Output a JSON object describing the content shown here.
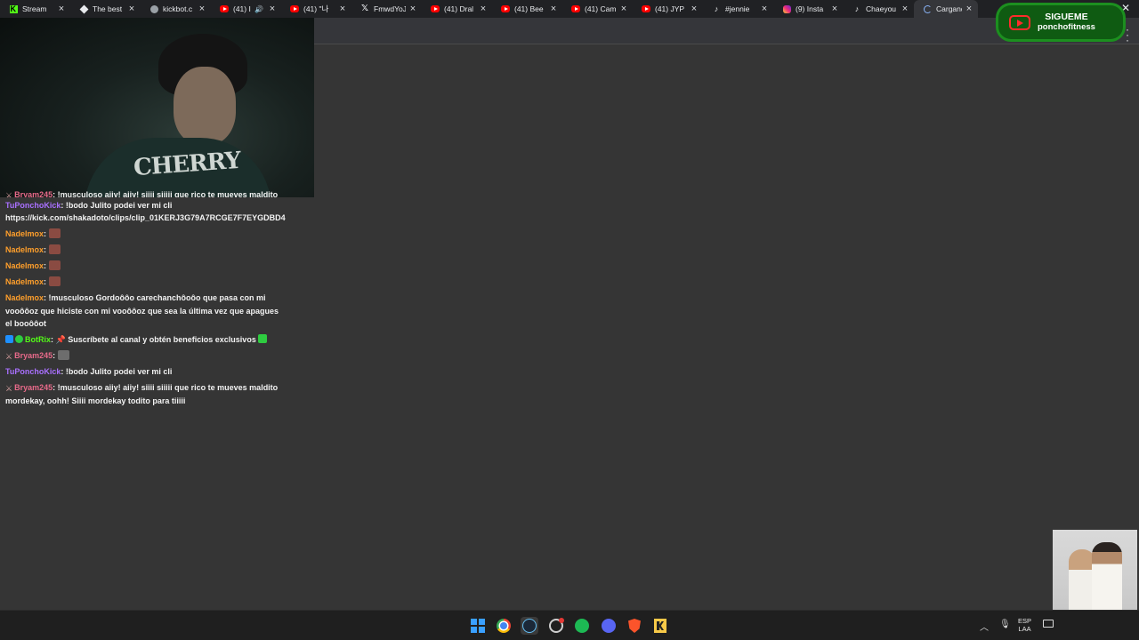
{
  "tabs": [
    {
      "title": "Stream",
      "icon": "kick-icon",
      "active": false
    },
    {
      "title": "The best",
      "icon": "github-icon",
      "active": false
    },
    {
      "title": "kickbot.c",
      "icon": "generic-icon",
      "active": false
    },
    {
      "title": "(41) I",
      "icon": "youtube-icon",
      "active": false,
      "muted": true
    },
    {
      "title": "(41) \"나",
      "icon": "youtube-icon",
      "active": false
    },
    {
      "title": "FmwdYoJ",
      "icon": "x-icon",
      "active": false
    },
    {
      "title": "(41) Dral",
      "icon": "youtube-icon",
      "active": false
    },
    {
      "title": "(41) Bee",
      "icon": "youtube-icon",
      "active": false
    },
    {
      "title": "(41) Cam",
      "icon": "youtube-icon",
      "active": false
    },
    {
      "title": "(41) JYP",
      "icon": "youtube-icon",
      "active": false
    },
    {
      "title": "#jennie",
      "icon": "tiktok-icon",
      "active": false
    },
    {
      "title": "(9) Insta",
      "icon": "instagram-icon",
      "active": false
    },
    {
      "title": "Chaeyou",
      "icon": "tiktok-icon",
      "active": false
    },
    {
      "title": "Cargand",
      "icon": "loading-icon",
      "active": true
    }
  ],
  "banner": {
    "title": "SIGUEME",
    "handle": "ponchofitness"
  },
  "webcam": {
    "shirt_text": "CHERRY"
  },
  "chat": [
    {
      "user": "Bryam245",
      "color": "#e86a8a",
      "badge": "sword",
      "text": ": !musculoso aiiy! aiiy! siiii siiiii que rico te mueves maldito mordekay, oohh! Siiii mordekay todito para tiiiii",
      "cut": true
    },
    {
      "user": "TuPonchoKick",
      "color": "#a970ff",
      "text": ": !bodo Julito podei ver mi cli https://kick.com/shakadoto/clips/clip_01KERJ3G79A7RCGE7F7EYGDBD4"
    },
    {
      "user": "Nadelmox",
      "color": "#ff9f2b",
      "text": ":",
      "emote": "red"
    },
    {
      "user": "Nadelmox",
      "color": "#ff9f2b",
      "text": ":",
      "emote": "red"
    },
    {
      "user": "Nadelmox",
      "color": "#ff9f2b",
      "text": ":",
      "emote": "red"
    },
    {
      "user": "Nadelmox",
      "color": "#ff9f2b",
      "text": ":",
      "emote": "red"
    },
    {
      "user": "Nadelmox",
      "color": "#ff9f2b",
      "text": ": !musculoso Gordoôôo carechanchôoôo que pasa con mi vooôôoz que hiciste con mi vooôôoz que sea la última vez que apagues el booôôot"
    },
    {
      "user": "BotRix",
      "color": "#53fc18",
      "badge": "bot",
      "text": ":",
      "pin": "📌",
      "text2": " Suscríbete al canal y obtén beneficios exclusivos ",
      "emote_end": "check"
    },
    {
      "user": "Bryam245",
      "color": "#e86a8a",
      "badge": "sword",
      "text": ":",
      "emote": "grey"
    },
    {
      "user": "TuPonchoKick",
      "color": "#a970ff",
      "text": ": !bodo Julito podei ver mi cli"
    },
    {
      "user": "Bryam245",
      "color": "#e86a8a",
      "badge": "sword",
      "text": ": !musculoso aiiy! aiiy! siiii siiiii que rico te mueves maldito mordekay, oohh! Siiii mordekay todito para tiiiii"
    }
  ],
  "taskbar": {
    "apps": [
      "windows-start",
      "chrome",
      "steam",
      "obs",
      "spotify",
      "discord",
      "brave",
      "kick"
    ],
    "lang_line1": "ESP",
    "lang_line2": "LAA"
  }
}
